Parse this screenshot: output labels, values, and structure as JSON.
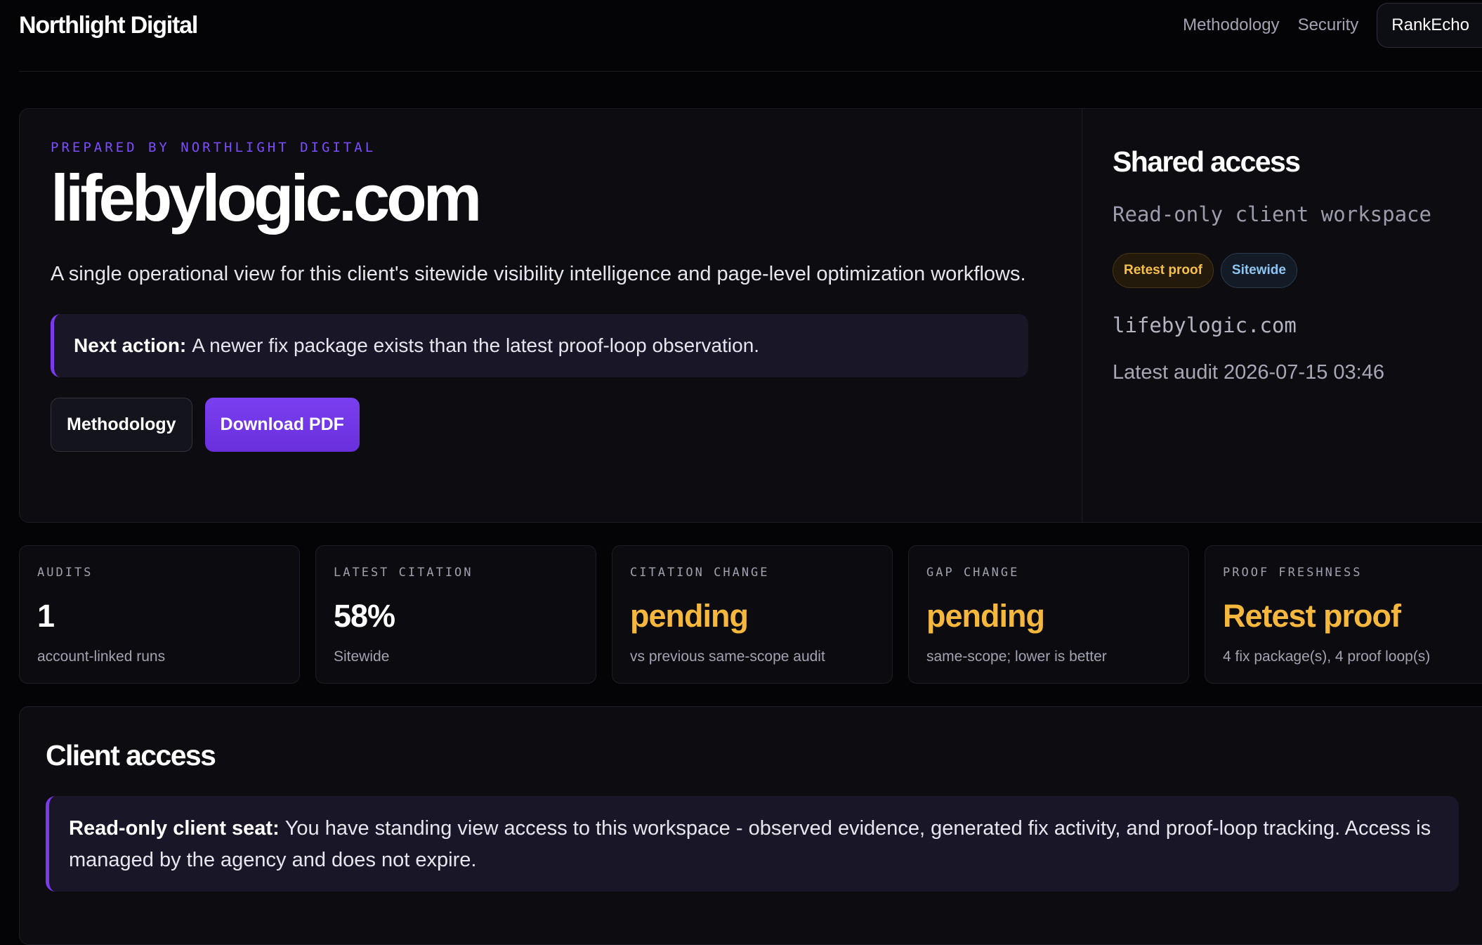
{
  "brand": "Northlight Digital",
  "nav": {
    "links": [
      "Methodology",
      "Security"
    ],
    "cta": "RankEcho"
  },
  "hero": {
    "eyebrow": "PREPARED BY NORTHLIGHT DIGITAL",
    "title": "lifebylogic.com",
    "description": "A single operational view for this client's sitewide visibility intelligence and page-level optimization workflows.",
    "next_action_label": "Next action:",
    "next_action_text": "A newer fix package exists than the latest proof-loop observation.",
    "buttons": {
      "methodology": "Methodology",
      "download": "Download PDF"
    }
  },
  "side": {
    "title": "Shared access",
    "subtitle": "Read-only client workspace",
    "badges": [
      "Retest proof",
      "Sitewide"
    ],
    "domain": "lifebylogic.com",
    "latest_audit": "Latest audit 2026-07-15 03:46"
  },
  "stats": [
    {
      "label": "AUDITS",
      "value": "1",
      "sub": "account-linked runs",
      "accent": "#ffffff"
    },
    {
      "label": "LATEST CITATION",
      "value": "58%",
      "sub": "Sitewide",
      "accent": "#ffffff"
    },
    {
      "label": "CITATION CHANGE",
      "value": "pending",
      "sub": "vs previous same-scope audit",
      "accent": "#f5b83d"
    },
    {
      "label": "GAP CHANGE",
      "value": "pending",
      "sub": "same-scope; lower is better",
      "accent": "#f5b83d"
    },
    {
      "label": "PROOF FRESHNESS",
      "value": "Retest proof",
      "sub": "4 fix package(s), 4 proof loop(s)",
      "accent": "#f5b83d"
    }
  ],
  "client_access": {
    "title": "Client access",
    "note_label": "Read-only client seat:",
    "note_text": "You have standing view access to this workspace - observed evidence, generated fix activity, and proof-loop tracking. Access is managed by the agency and does not expire."
  },
  "colors": {
    "accent_purple": "#7c3aed",
    "amber": "#f5b83d",
    "background": "#040406"
  }
}
